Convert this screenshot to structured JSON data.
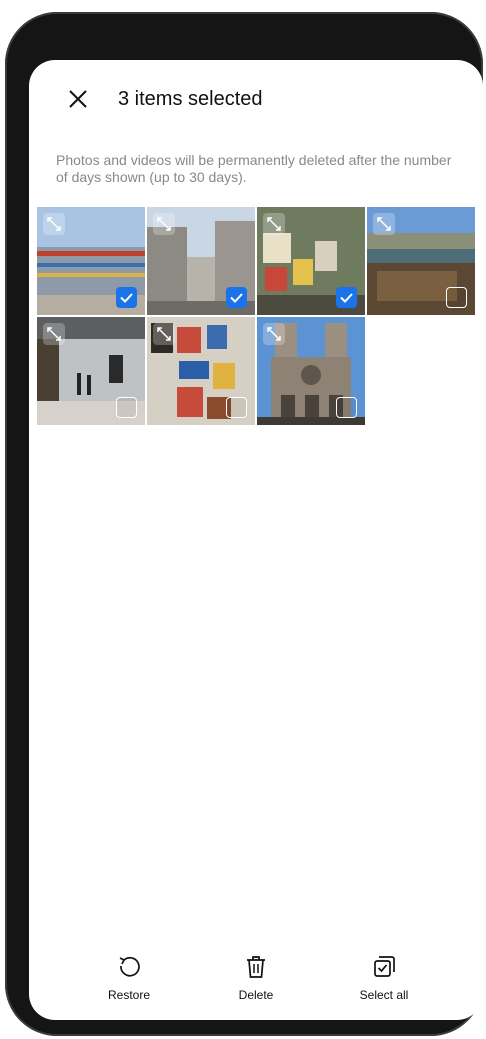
{
  "header": {
    "title": "3 items selected",
    "close_icon": "close-icon"
  },
  "notice": "Photos and videos will be permanently deleted after the number of days shown (up to 30 days).",
  "photos": [
    {
      "name": "colorful-building",
      "selected": true
    },
    {
      "name": "street-buildings",
      "selected": true
    },
    {
      "name": "street-posters",
      "selected": true
    },
    {
      "name": "river-locks",
      "selected": false
    },
    {
      "name": "gallery-hall",
      "selected": false
    },
    {
      "name": "poster-wall",
      "selected": false
    },
    {
      "name": "cathedral",
      "selected": false
    }
  ],
  "actions": {
    "restore": {
      "label": "Restore",
      "icon": "restore-icon"
    },
    "delete": {
      "label": "Delete",
      "icon": "trash-icon"
    },
    "select_all": {
      "label": "Select all",
      "icon": "select-all-icon"
    }
  },
  "colors": {
    "accent": "#1a73e8"
  }
}
